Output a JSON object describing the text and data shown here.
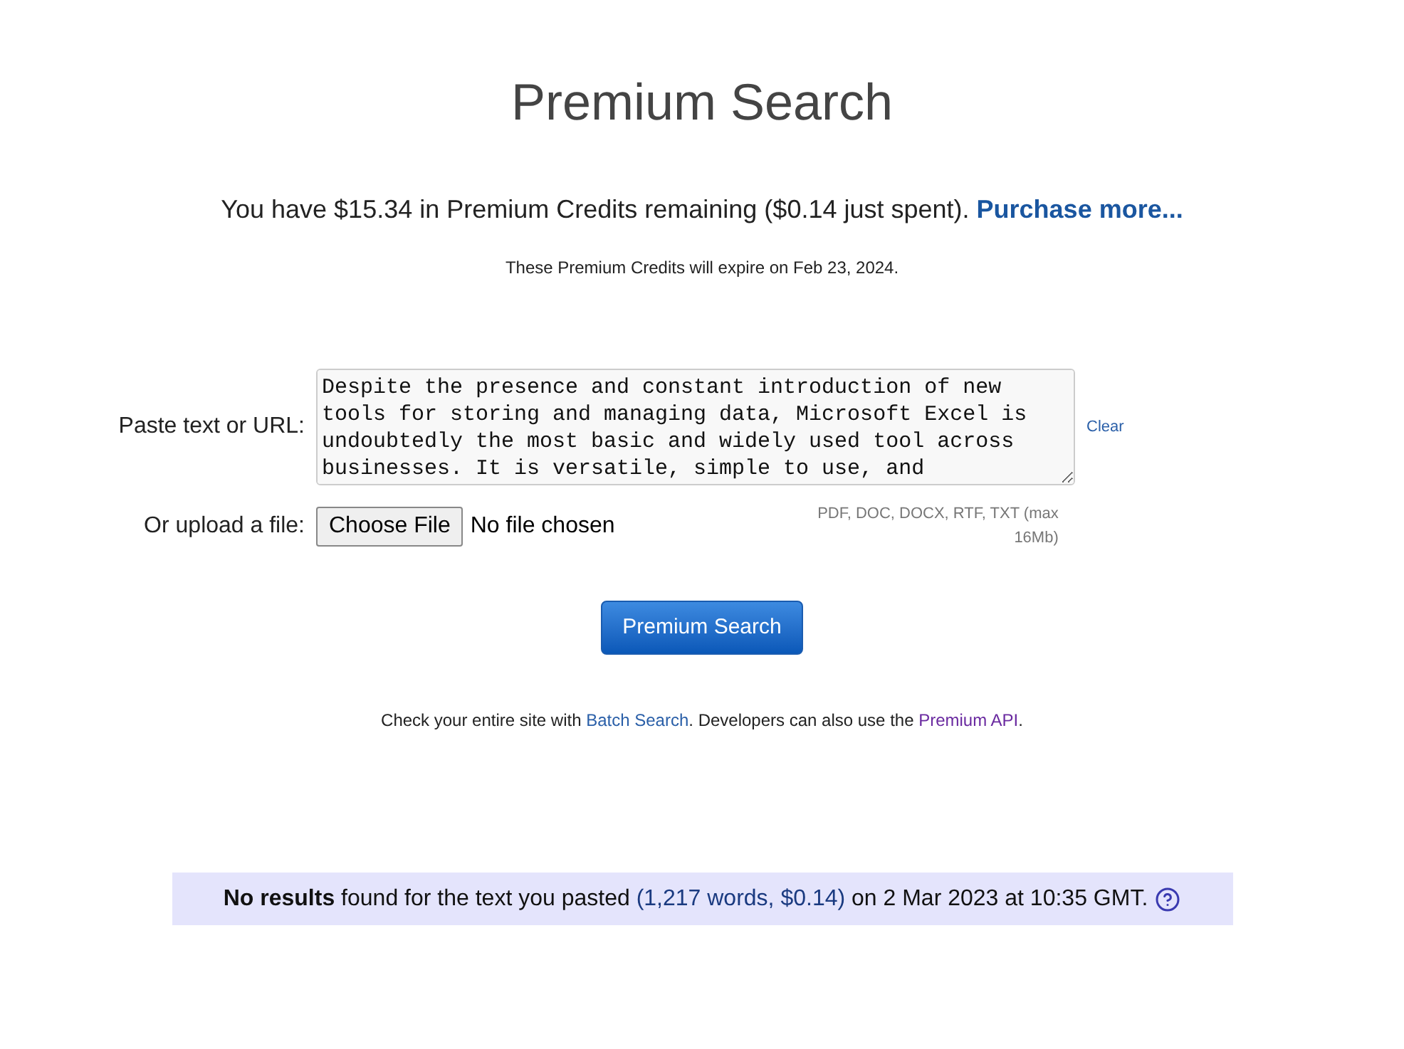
{
  "title": "Premium Search",
  "credits": {
    "text": "You have $15.34 in Premium Credits remaining ($0.14 just spent).",
    "link": "Purchase more..."
  },
  "expiry": "These Premium Credits will expire on Feb 23, 2024.",
  "paste": {
    "label": "Paste text or URL:",
    "value": "Despite the presence and constant introduction of new tools for storing and managing data, Microsoft Excel is undoubtedly the most basic and widely used tool across businesses. It is versatile, simple to use, and",
    "clear": "Clear"
  },
  "upload": {
    "label": "Or upload a file:",
    "button": "Choose File",
    "status": "No file chosen",
    "hint": "PDF, DOC, DOCX, RTF, TXT (max 16Mb)"
  },
  "submit": "Premium Search",
  "footer": {
    "before": "Check your entire site with",
    "link1": "Batch Search",
    "middle": ". Developers can also use the",
    "link2": "Premium API",
    "after": "."
  },
  "result": {
    "before": "**No results** found for the text you pasted",
    "link": "(1,217 words, $0.14)",
    "after": "on 2 Mar 2023 at 10:35 GMT."
  }
}
